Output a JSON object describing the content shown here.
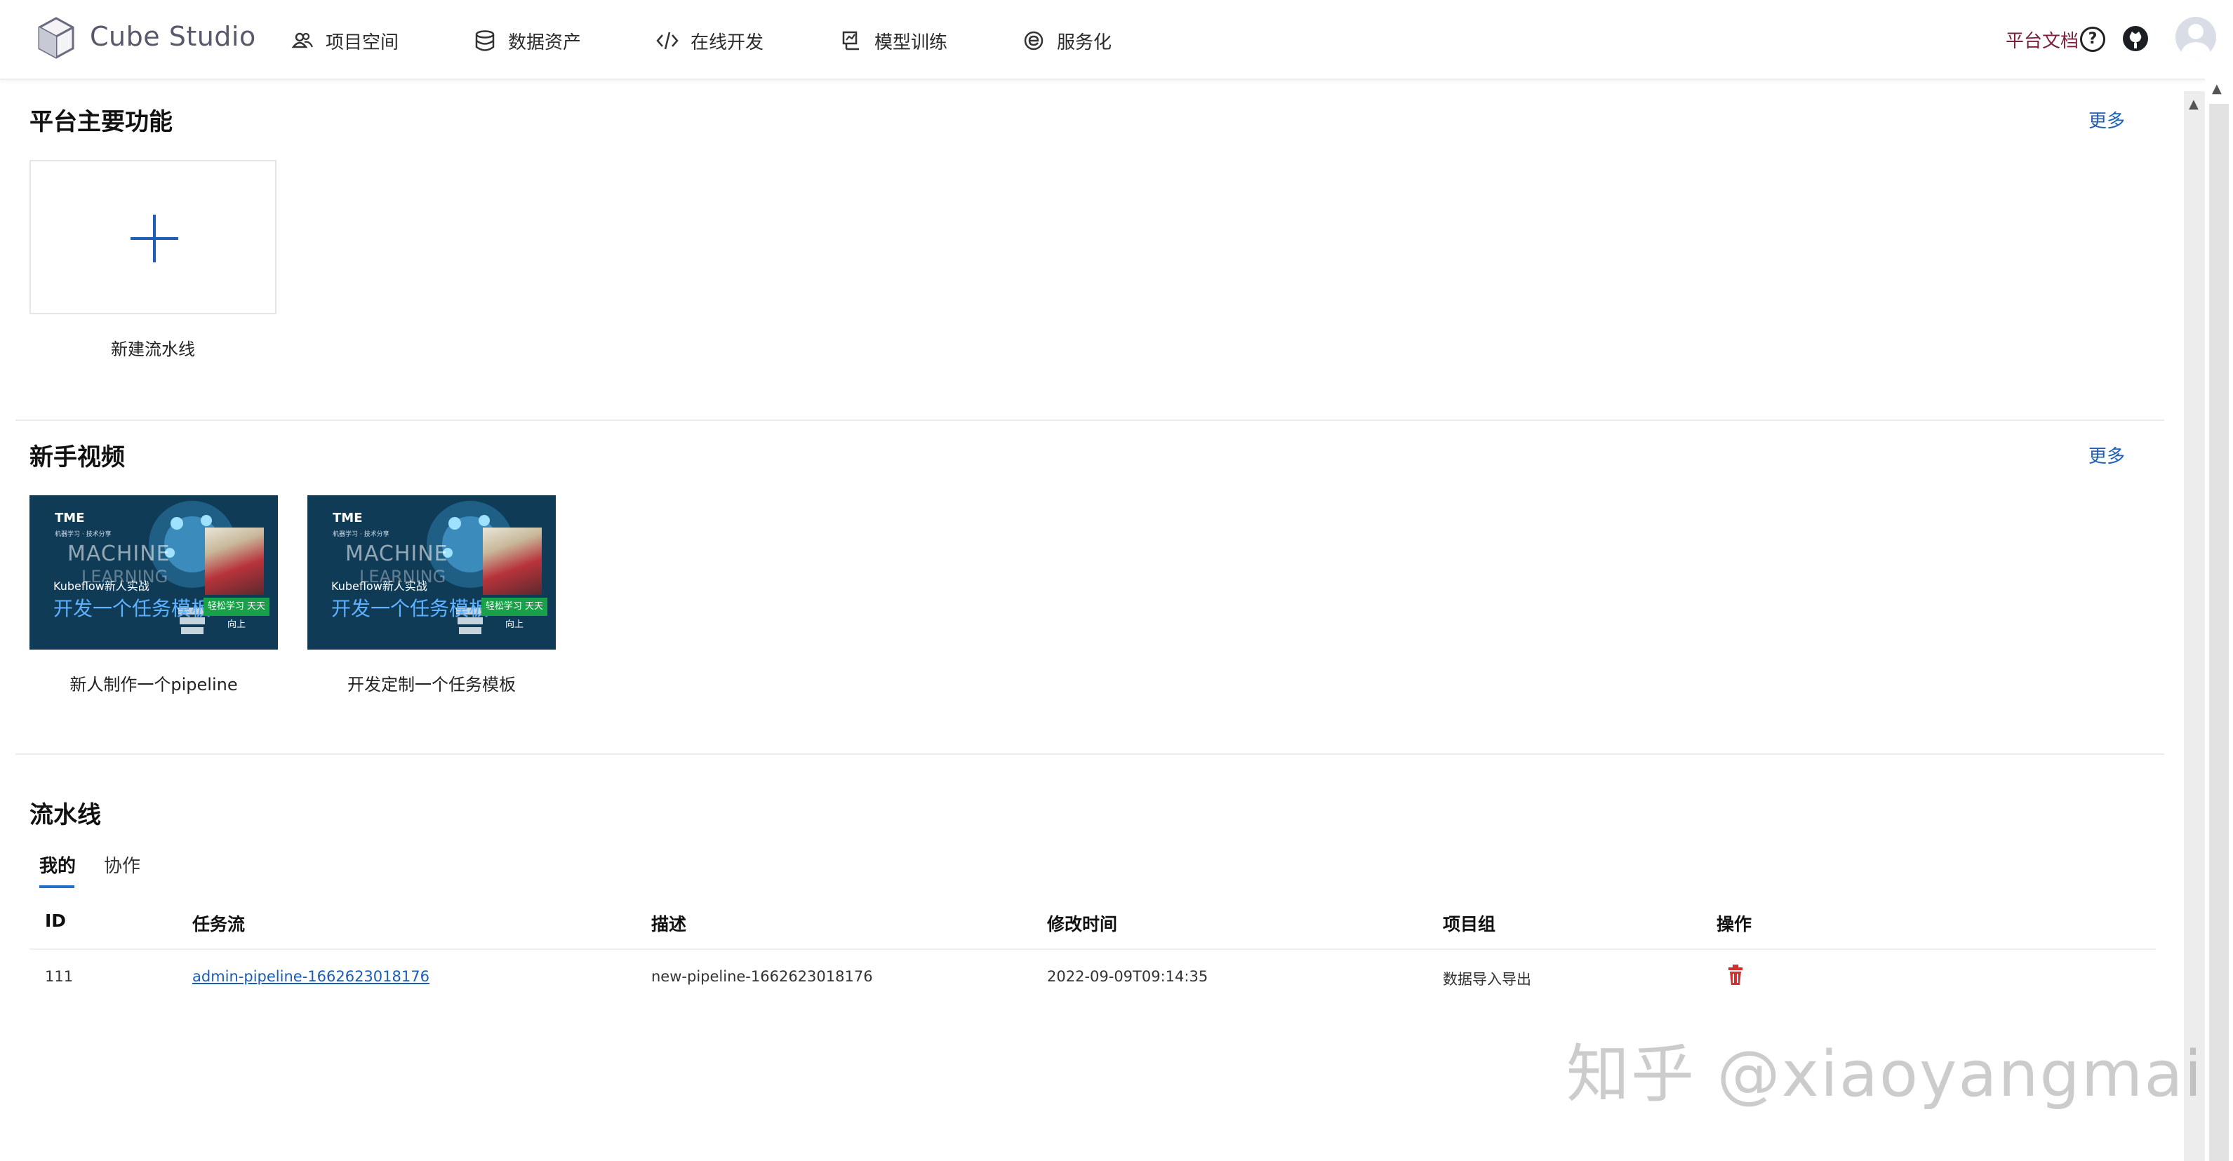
{
  "header": {
    "brand": "Cube Studio",
    "nav": [
      {
        "label": "项目空间",
        "icon": "team-icon"
      },
      {
        "label": "数据资产",
        "icon": "database-icon"
      },
      {
        "label": "在线开发",
        "icon": "code-icon"
      },
      {
        "label": "模型训练",
        "icon": "model-icon"
      },
      {
        "label": "服务化",
        "icon": "service-icon"
      }
    ],
    "doc_link": "平台文档",
    "help_glyph": "?"
  },
  "features": {
    "title": "平台主要功能",
    "more": "更多",
    "cards": [
      {
        "label": "新建流水线",
        "icon": "plus-icon"
      }
    ]
  },
  "videos": {
    "title": "新手视频",
    "more": "更多",
    "items": [
      {
        "caption": "新人制作一个pipeline",
        "thumb": {
          "logo": "TME",
          "sub": "机器学习 · 技术分享",
          "machine": "MACHINE",
          "learning": "LEARNING",
          "kube": "Kubeflow新人实战",
          "title": "开发一个任务模板",
          "banner": "轻松学习 天天向上"
        }
      },
      {
        "caption": "开发定制一个任务模板",
        "thumb": {
          "logo": "TME",
          "sub": "机器学习 · 技术分享",
          "machine": "MACHINE",
          "learning": "LEARNING",
          "kube": "Kubeflow新人实战",
          "title": "开发一个任务模板",
          "banner": "轻松学习 天天向上"
        }
      }
    ]
  },
  "pipelines": {
    "title": "流水线",
    "tabs": [
      {
        "label": "我的",
        "active": true
      },
      {
        "label": "协作",
        "active": false
      }
    ],
    "columns": [
      "ID",
      "任务流",
      "描述",
      "修改时间",
      "项目组",
      "操作"
    ],
    "rows": [
      {
        "id": "111",
        "name": "admin-pipeline-1662623018176",
        "description": "new-pipeline-1662623018176",
        "modified": "2022-09-09T09:14:35",
        "project": "数据导入导出",
        "action_icon": "trash-icon"
      }
    ]
  },
  "watermark": "知乎 @xiaoyangmai",
  "colors": {
    "accent": "#1f5fb8",
    "doc_link": "#7a1f3d",
    "delete": "#d03030",
    "tab_underline": "#1f70c8"
  }
}
